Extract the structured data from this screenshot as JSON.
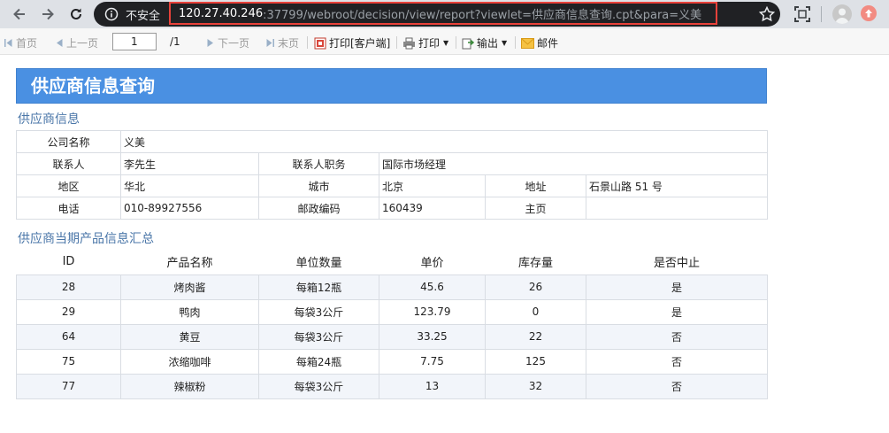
{
  "browser": {
    "insecure_label": "不安全",
    "url_host": "120.27.40.246",
    "url_rest": ":37799/webroot/decision/view/report?viewlet=供应商信息查询.cpt&para=义美"
  },
  "toolbar": {
    "first": "首页",
    "prev": "上一页",
    "page_value": "1",
    "total_pages": "/1",
    "next": "下一页",
    "last": "末页",
    "print_client": "打印[客户端]",
    "print": "打印",
    "export": "输出",
    "email": "邮件"
  },
  "report": {
    "title": "供应商信息查询",
    "supplier_section": "供应商信息",
    "supplier": {
      "company_label": "公司名称",
      "company": "义美",
      "contact_label": "联系人",
      "contact": "李先生",
      "contact_title_label": "联系人职务",
      "contact_title": "国际市场经理",
      "region_label": "地区",
      "region": "华北",
      "city_label": "城市",
      "city": "北京",
      "address_label": "地址",
      "address": "石景山路 51 号",
      "phone_label": "电话",
      "phone": "010-89927556",
      "postcode_label": "邮政编码",
      "postcode": "160439",
      "homepage_label": "主页",
      "homepage": ""
    },
    "products_section": "供应商当期产品信息汇总",
    "product_columns": [
      "ID",
      "产品名称",
      "单位数量",
      "单价",
      "库存量",
      "是否中止"
    ],
    "products": [
      [
        "28",
        "烤肉酱",
        "每箱12瓶",
        "45.6",
        "26",
        "是"
      ],
      [
        "29",
        "鸭肉",
        "每袋3公斤",
        "123.79",
        "0",
        "是"
      ],
      [
        "64",
        "黄豆",
        "每袋3公斤",
        "33.25",
        "22",
        "否"
      ],
      [
        "75",
        "浓缩咖啡",
        "每箱24瓶",
        "7.75",
        "125",
        "否"
      ],
      [
        "77",
        "辣椒粉",
        "每袋3公斤",
        "13",
        "32",
        "否"
      ]
    ]
  }
}
